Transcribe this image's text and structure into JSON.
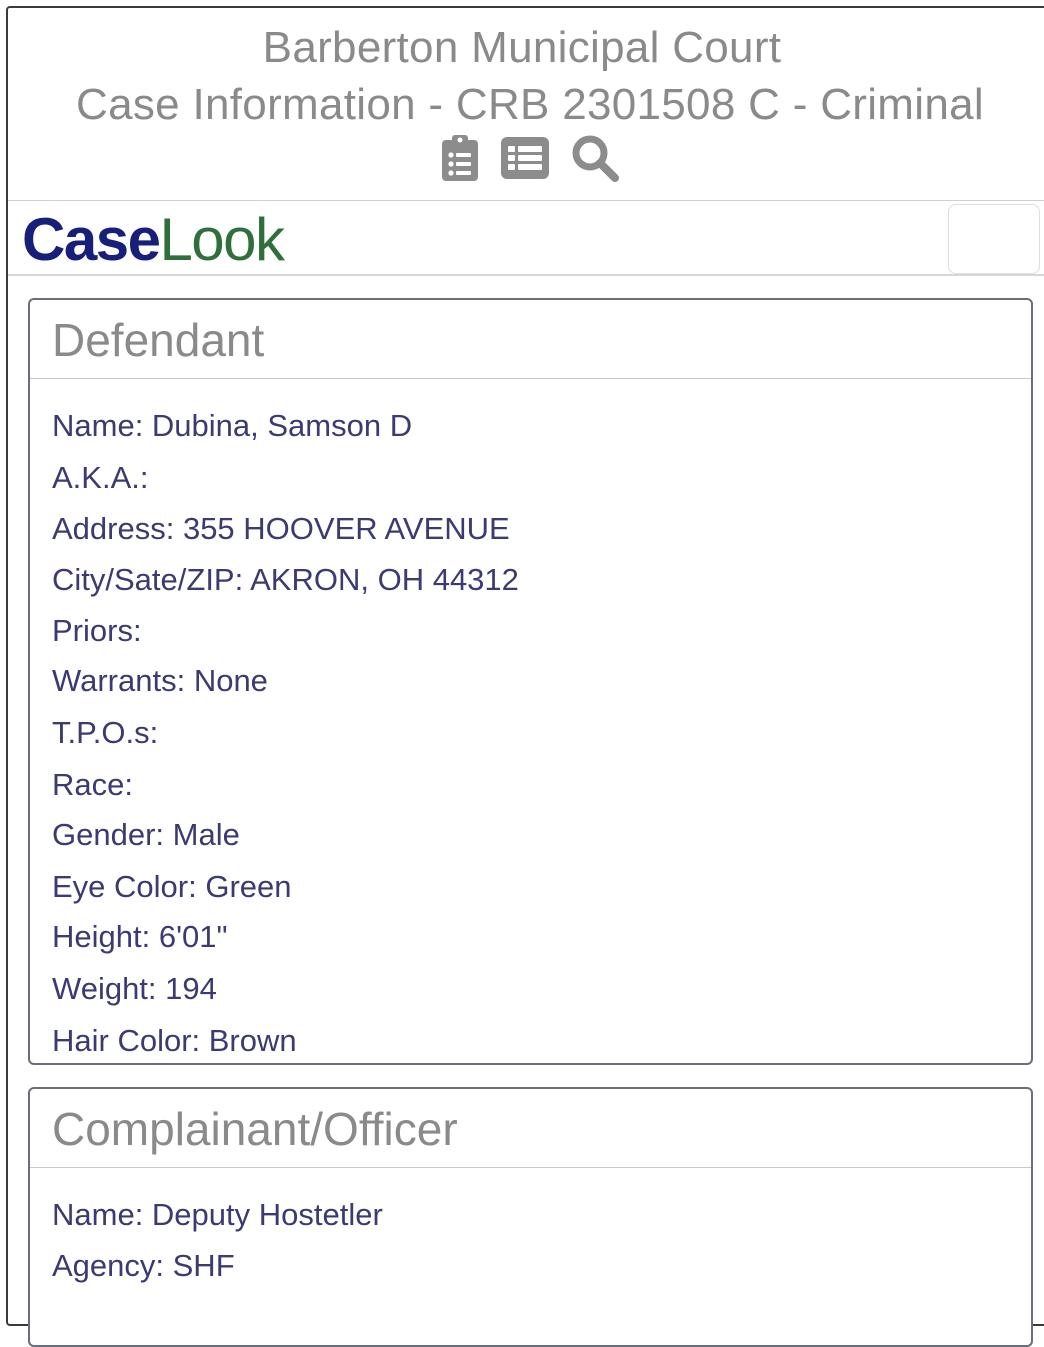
{
  "header": {
    "court_name": "Barberton Municipal Court",
    "case_title": "Case Information - CRB 2301508 C - Criminal",
    "icons": [
      "clipboard-list-icon",
      "list-icon",
      "search-icon"
    ]
  },
  "brand": {
    "logo_part1": "Case",
    "logo_part2": "Look",
    "logo_color_case": "#16207a",
    "logo_color_look": "#2f6f3a"
  },
  "defendant": {
    "title": "Defendant",
    "fields": [
      "Name: Dubina, Samson D",
      "A.K.A.:",
      "Address: 355 HOOVER AVENUE",
      "City/Sate/ZIP: AKRON, OH 44312",
      "Priors:",
      "Warrants: None",
      "T.P.O.s:",
      "Race:",
      "Gender: Male",
      "Eye Color: Green",
      "Height: 6'01\"",
      "Weight: 194",
      "Hair Color: Brown"
    ]
  },
  "complainant": {
    "title": "Complainant/Officer",
    "fields": [
      "Name: Deputy Hostetler",
      "Agency: SHF"
    ]
  },
  "colors": {
    "field_text": "#3b3a72",
    "header_text": "#8a8a8a",
    "icon_gray": "#8c8c8c"
  }
}
